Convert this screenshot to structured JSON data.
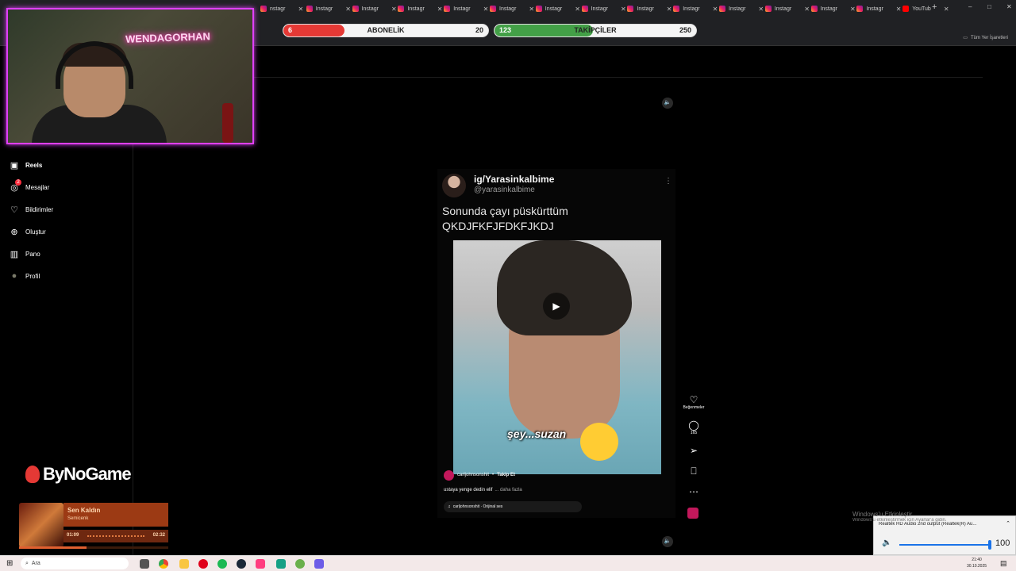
{
  "browser": {
    "tabs": [
      {
        "label": "nstagr",
        "icon": "instagram-icon"
      },
      {
        "label": "Instagr",
        "icon": "instagram-icon"
      },
      {
        "label": "Instagr",
        "icon": "instagram-icon"
      },
      {
        "label": "Instagr",
        "icon": "instagram-icon"
      },
      {
        "label": "Instagr",
        "icon": "instagram-icon"
      },
      {
        "label": "Instagr",
        "icon": "instagram-icon"
      },
      {
        "label": "Instagr",
        "icon": "instagram-icon"
      },
      {
        "label": "Instagr",
        "icon": "instagram-icon"
      },
      {
        "label": "Instagr",
        "icon": "instagram-icon"
      },
      {
        "label": "Instagr",
        "icon": "instagram-icon"
      },
      {
        "label": "Instagr",
        "icon": "instagram-icon"
      },
      {
        "label": "Instagr",
        "icon": "instagram-icon"
      },
      {
        "label": "Instagr",
        "icon": "instagram-icon"
      },
      {
        "label": "Instagr",
        "icon": "instagram-icon"
      },
      {
        "label": "YouTub",
        "icon": "youtube-icon"
      }
    ],
    "new_tab": "+",
    "close_tab": "✕",
    "bookmarks_label": "Tüm Yer İşaretleri"
  },
  "stream_bars": {
    "subs": {
      "current": "6",
      "label": "ABONELİK",
      "goal": "20",
      "progress": 0.3,
      "color": "#e53935"
    },
    "followers": {
      "current": "123",
      "label": "TAKİPÇİLER",
      "goal": "250",
      "progress": 0.49,
      "color": "#43a047"
    }
  },
  "webcam": {
    "neon_text": "WENDAGORHAN"
  },
  "sidebar": {
    "items": [
      {
        "label": "Reels",
        "icon": "reels-icon"
      },
      {
        "label": "Mesajlar",
        "icon": "messenger-icon",
        "badge": "2"
      },
      {
        "label": "Bildirimler",
        "icon": "heart-icon"
      },
      {
        "label": "Oluştur",
        "icon": "plus-icon"
      },
      {
        "label": "Pano",
        "icon": "dashboard-icon"
      },
      {
        "label": "Profil",
        "icon": "avatar"
      }
    ]
  },
  "reel": {
    "display_name": "ig/Yarasinkalbime",
    "handle": "@yarasinkalbime",
    "text_line1": "Sonunda çayı püskürttüm",
    "text_line2": "QKDJFKFJFDKFJKDJ",
    "video_caption": "şey...suzan",
    "author": "carljohnsonshit",
    "follow_label": "Takip Et",
    "description": "ustaya yenge dedin elif",
    "more_label": "... daha fazla",
    "audio": "carljohnsonshit · Orijinal ses",
    "likes_label": "Beğenmeler",
    "comments_count": "165"
  },
  "brand": {
    "logo_text": "ByNoGame"
  },
  "music": {
    "title": "Sen Kaldın",
    "artist": "Semicenk",
    "elapsed": "01:09",
    "duration": "02:32",
    "progress": 0.45
  },
  "taskbar": {
    "search_placeholder": "Ara",
    "time": "21:40",
    "date": "30.10.2025"
  },
  "volume_popup": {
    "device": "Realtek HD Audio 2nd output (Realtek(R) Au...",
    "level": "100"
  },
  "watermark": {
    "line1": "Windows'u Etkinleştir",
    "line2": "Windows'u etkinleştirmek için Ayarlar'a gidin."
  }
}
